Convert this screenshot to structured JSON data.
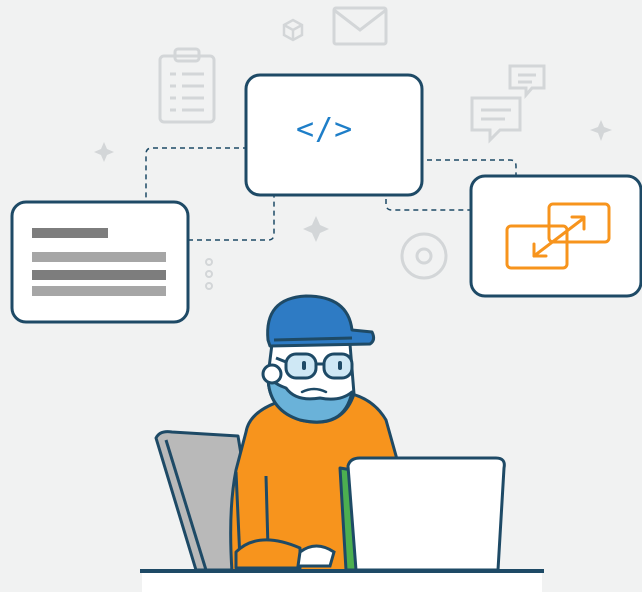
{
  "illustration": {
    "code_card": {
      "code_text": "</>"
    },
    "colors": {
      "background": "#f1f2f2",
      "outline": "#1e4a66",
      "accent_orange": "#f7941d",
      "code_blue": "#1e7ec8",
      "cap_blue": "#2e7bc4",
      "beard_blue": "#6ab2d9",
      "laptop_green": "#4caf50",
      "chair_gray": "#b9b9b9",
      "faint_icon": "#d3d6d8"
    },
    "icons": [
      "clipboard-icon",
      "envelope-icon",
      "cube-icon",
      "chat-icon",
      "sparkle-icon",
      "target-icon",
      "swap-arrows-icon"
    ]
  }
}
